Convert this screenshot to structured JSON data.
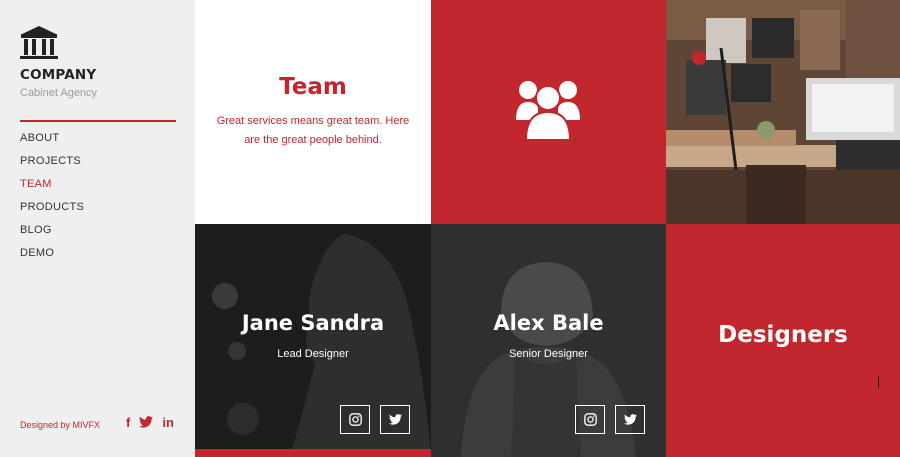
{
  "brand": {
    "name": "COMPANY",
    "tagline": "Cabinet Agency",
    "logo_icon": "bank-building-icon"
  },
  "nav": {
    "items": [
      {
        "label": "ABOUT",
        "active": false
      },
      {
        "label": "PROJECTS",
        "active": false
      },
      {
        "label": "TEAM",
        "active": true
      },
      {
        "label": "PRODUCTS",
        "active": false
      },
      {
        "label": "BLOG",
        "active": false
      },
      {
        "label": "DEMO",
        "active": false
      }
    ]
  },
  "footer": {
    "credit": "Designed by MIVFX",
    "social": [
      {
        "icon": "facebook-icon",
        "glyph": "f"
      },
      {
        "icon": "twitter-icon",
        "glyph": ""
      },
      {
        "icon": "linkedin-icon",
        "glyph": "in"
      }
    ]
  },
  "team_intro": {
    "title": "Team",
    "text": "Great services means great team. Here are the great people behind."
  },
  "members": [
    {
      "name": "Jane Sandra",
      "role": "Lead Designer"
    },
    {
      "name": "Alex Bale",
      "role": "Senior Designer"
    }
  ],
  "designers_tile": {
    "label": "Designers"
  },
  "colors": {
    "accent": "#c1272d",
    "sidebar_bg": "#efefef",
    "text_dark": "#222222"
  }
}
